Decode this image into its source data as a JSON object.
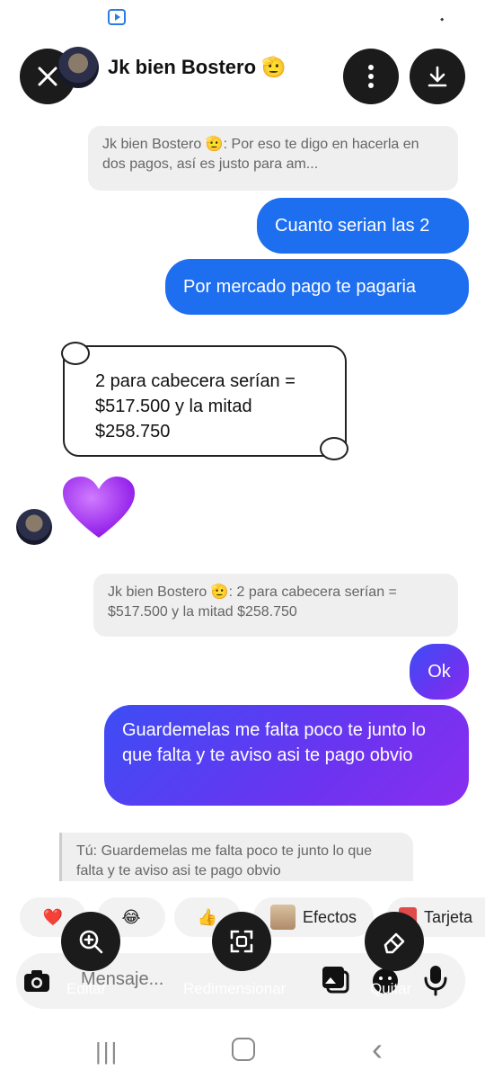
{
  "header": {
    "contact_name": "Jk bien Bostero",
    "contact_emoji": "🫡"
  },
  "messages": {
    "quote1": "Jk bien Bostero 🫡: Por eso te digo en hacerla en dos pagos, así es justo para am...",
    "sent1": "Cuanto serian las 2",
    "sent2": "Por mercado pago te pagaria",
    "received_scroll_line1": "2 para cabecera serían =",
    "received_scroll_line2": "$517.500 y la mitad",
    "received_scroll_line3": "$258.750",
    "received_heart": "💜",
    "quote2": "Jk bien Bostero 🫡: 2 para cabecera serían = $517.500 y la mitad $258.750",
    "sent3": "Ok",
    "sent4": "Guardemelas me falta poco te junto lo que falta y te aviso asi te pago obvio",
    "quote3": "Tú: Guardemelas me falta poco te junto lo que falta y te aviso asi te pago obvio"
  },
  "chips": {
    "heart": "❤️",
    "laugh": "😂",
    "thumbs": "👍",
    "effects_label": "Efectos",
    "card_label": "Tarjeta"
  },
  "composer": {
    "placeholder": "Mensaje..."
  },
  "tools": {
    "edit_label": "Editar",
    "resize_label": "Redimensionar",
    "remove_label": "Quitar"
  },
  "navbar": {
    "recents": "|||",
    "home": "◯",
    "back": "‹"
  },
  "colors": {
    "sent_blue": "#1e6ef0",
    "sent_gradient_start": "#3d4df5",
    "sent_gradient_end": "#8a2ef0",
    "tool_dark": "#1b1b1b"
  }
}
